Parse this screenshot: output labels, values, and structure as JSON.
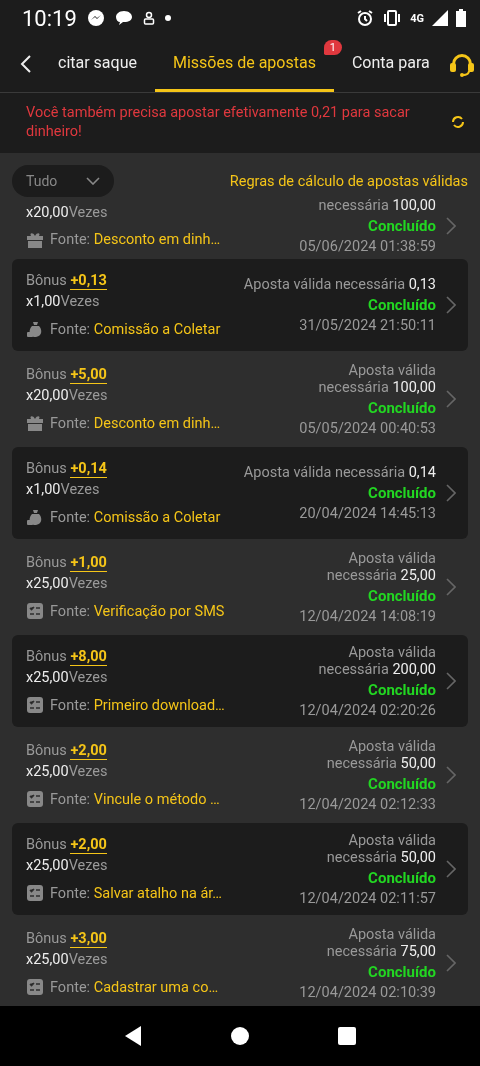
{
  "status_bar": {
    "time": "10:19",
    "network": "4G"
  },
  "header": {
    "tabs": [
      {
        "label": "citar saque",
        "selected": false
      },
      {
        "label": "Missões de apostas",
        "selected": true,
        "badge": "1"
      },
      {
        "label": "Conta para",
        "selected": false
      }
    ]
  },
  "notice": "Você também precisa apostar efetivamente 0,21 para sacar dinheiro!",
  "filter": {
    "value": "Tudo"
  },
  "rules_link": "Regras de cálculo de apostas válidas",
  "missions": [
    {
      "partial": true,
      "card": false,
      "kind": "gift",
      "multiplier": "x20,00",
      "times_label": "Vezes",
      "required_label": "necessária",
      "required_value": "100,00",
      "status": "Concluído",
      "source_label": "Fonte:",
      "source": "Desconto em dinh…",
      "date": "05/06/2024 01:38:59"
    },
    {
      "card": true,
      "kind": "bag",
      "bonus_label": "Bônus",
      "bonus": "+0,13",
      "multiplier": "x1,00",
      "times_label": "Vezes",
      "required_label": "Aposta válida necessária",
      "required_value": "0,13",
      "status": "Concluído",
      "source_label": "Fonte:",
      "source": "Comissão a Coletar",
      "date": "31/05/2024 21:50:11"
    },
    {
      "card": false,
      "kind": "gift",
      "bonus_label": "Bônus",
      "bonus": "+5,00",
      "multiplier": "x20,00",
      "times_label": "Vezes",
      "required_label": "Aposta válida necessária",
      "required_value": "100,00",
      "status": "Concluído",
      "source_label": "Fonte:",
      "source": "Desconto em dinh…",
      "date": "05/05/2024 00:40:53"
    },
    {
      "card": true,
      "kind": "bag",
      "bonus_label": "Bônus",
      "bonus": "+0,14",
      "multiplier": "x1,00",
      "times_label": "Vezes",
      "required_label": "Aposta válida necessária",
      "required_value": "0,14",
      "status": "Concluído",
      "source_label": "Fonte:",
      "source": "Comissão a Coletar",
      "date": "20/04/2024 14:45:13"
    },
    {
      "card": false,
      "kind": "list",
      "bonus_label": "Bônus",
      "bonus": "+1,00",
      "multiplier": "x25,00",
      "times_label": "Vezes",
      "required_label": "Aposta válida necessária",
      "required_value": "25,00",
      "status": "Concluído",
      "source_label": "Fonte:",
      "source": "Verificação por SMS",
      "date": "12/04/2024 14:08:19"
    },
    {
      "card": true,
      "kind": "list",
      "bonus_label": "Bônus",
      "bonus": "+8,00",
      "multiplier": "x25,00",
      "times_label": "Vezes",
      "required_label": "Aposta válida necessária",
      "required_value": "200,00",
      "status": "Concluído",
      "source_label": "Fonte:",
      "source": "Primeiro download…",
      "date": "12/04/2024 02:20:26"
    },
    {
      "card": false,
      "kind": "list",
      "bonus_label": "Bônus",
      "bonus": "+2,00",
      "multiplier": "x25,00",
      "times_label": "Vezes",
      "required_label": "Aposta válida necessária",
      "required_value": "50,00",
      "status": "Concluído",
      "source_label": "Fonte:",
      "source": "Vincule o método …",
      "date": "12/04/2024 02:12:33"
    },
    {
      "card": true,
      "kind": "list",
      "bonus_label": "Bônus",
      "bonus": "+2,00",
      "multiplier": "x25,00",
      "times_label": "Vezes",
      "required_label": "Aposta válida necessária",
      "required_value": "50,00",
      "status": "Concluído",
      "source_label": "Fonte:",
      "source": "Salvar atalho na ár…",
      "date": "12/04/2024 02:11:57"
    },
    {
      "card": false,
      "kind": "list",
      "bonus_label": "Bônus",
      "bonus": "+3,00",
      "multiplier": "x25,00",
      "times_label": "Vezes",
      "required_label": "Aposta válida necessária",
      "required_value": "75,00",
      "status": "Concluído",
      "source_label": "Fonte:",
      "source": "Cadastrar uma co…",
      "date": "12/04/2024 02:10:39"
    }
  ]
}
